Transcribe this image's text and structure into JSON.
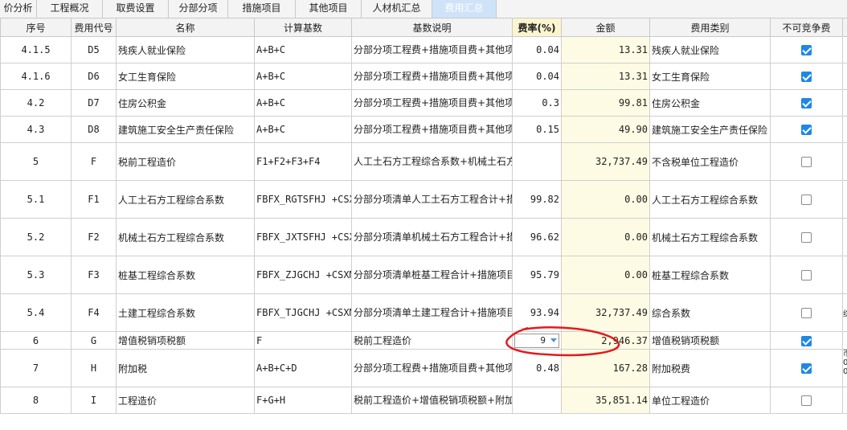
{
  "tabs": [
    {
      "label": "价分析"
    },
    {
      "label": "工程概况"
    },
    {
      "label": "取费设置"
    },
    {
      "label": "分部分项"
    },
    {
      "label": "措施项目"
    },
    {
      "label": "其他项目"
    },
    {
      "label": "人材机汇总"
    },
    {
      "label": "费用汇总",
      "active": true
    }
  ],
  "columns": [
    "序号",
    "费用代号",
    "名称",
    "计算基数",
    "基数说明",
    "费率(%)",
    "金额",
    "费用类别",
    "不可竞争费"
  ],
  "rows": [
    {
      "seq": "4.1.5",
      "code": "D5",
      "name": "残疾人就业保险",
      "base": "A+B+C",
      "desc": "分部分项工程费+措施项目费+其他项目费",
      "rate": "0.04",
      "amount": "13.31",
      "category": "残疾人就业保险",
      "noncompete": true
    },
    {
      "seq": "4.1.6",
      "code": "D6",
      "name": "女工生育保险",
      "base": "A+B+C",
      "desc": "分部分项工程费+措施项目费+其他项目费",
      "rate": "0.04",
      "amount": "13.31",
      "category": "女工生育保险",
      "noncompete": true
    },
    {
      "seq": "4.2",
      "code": "D7",
      "name": "住房公积金",
      "base": "A+B+C",
      "desc": "分部分项工程费+措施项目费+其他项目费",
      "rate": "0.3",
      "amount": "99.81",
      "category": "住房公积金",
      "noncompete": true
    },
    {
      "seq": "4.3",
      "code": "D8",
      "name": "建筑施工安全生产责任保险",
      "base": "A+B+C",
      "desc": "分部分项工程费+措施项目费+其他项目费",
      "rate": "0.15",
      "amount": "49.90",
      "category": "建筑施工安全生产责任保险",
      "noncompete": true
    },
    {
      "seq": "5",
      "code": "F",
      "name": "税前工程造价",
      "base": "F1+F2+F3+F4",
      "desc": "人工土石方工程综合系数+机械土石方工程综合系数+桩基工程综合系数+土建工程综合系数",
      "rate": "",
      "amount": "32,737.49",
      "category": "不含税单位工程造价",
      "noncompete": false
    },
    {
      "seq": "5.1",
      "code": "F1",
      "name": "人工土石方工程综合系数",
      "base": "FBFX_RGTSFHJ +CSXM_RGTSFHJ +GF_RGTSFHJ",
      "desc": "分部分项清单人工土石方工程合计+措施项目人工土石方工程合计+规费人工土石方工程合计",
      "rate": "99.82",
      "amount": "0.00",
      "category": "人工土石方工程综合系数",
      "noncompete": false
    },
    {
      "seq": "5.2",
      "code": "F2",
      "name": "机械土石方工程综合系数",
      "base": "FBFX_JXTSFHJ +CSXM_JXTSFHJ +GF_JXTSFHJ",
      "desc": "分部分项清单机械土石方工程合计+措施项目机械土石方工程合计+规费机械土石方工程合计",
      "rate": "96.62",
      "amount": "0.00",
      "category": "机械土石方工程综合系数",
      "noncompete": false
    },
    {
      "seq": "5.3",
      "code": "F3",
      "name": "桩基工程综合系数",
      "base": "FBFX_ZJGCHJ +CSXM_ZJGCHJ +GF_ZJGCHJ",
      "desc": "分部分项清单桩基工程合计+措施项目桩基工程合计+规费桩基工程合计",
      "rate": "95.79",
      "amount": "0.00",
      "category": "桩基工程综合系数",
      "noncompete": false
    },
    {
      "seq": "5.4",
      "code": "F4",
      "name": "土建工程综合系数",
      "base": "FBFX_TJGCHJ +CSXM_TJGCHJ +GF_TJGCHJ+C",
      "desc": "分部分项清单土建工程合计+措施项目土建工程合计+规费土建工程合计+其他项目费",
      "rate": "93.94",
      "amount": "32,737.49",
      "category": "综合系数",
      "noncompete": false
    },
    {
      "seq": "6",
      "code": "G",
      "name": "增值税销项税额",
      "base": "F",
      "desc": "税前工程造价",
      "rate": "9",
      "amount": "2,946.37",
      "category": "增值税销项税额",
      "noncompete": true
    },
    {
      "seq": "7",
      "code": "H",
      "name": "附加税",
      "base": "A+B+C+D",
      "desc": "分部分项工程费+措施项目费+其他项目费+规费",
      "rate": "0.48",
      "amount": "167.28",
      "category": "附加税费",
      "noncompete": true
    },
    {
      "seq": "8",
      "code": "I",
      "name": "工程造价",
      "base": "F+G+H",
      "desc": "税前工程造价+增值税销项税额+附加税",
      "rate": "",
      "amount": "35,851.14",
      "category": "单位工程造价",
      "noncompete": false
    }
  ],
  "edge_fragments": {
    "row_5_4": "综",
    "row_7": [
      "币",
      "0",
      "0"
    ]
  }
}
